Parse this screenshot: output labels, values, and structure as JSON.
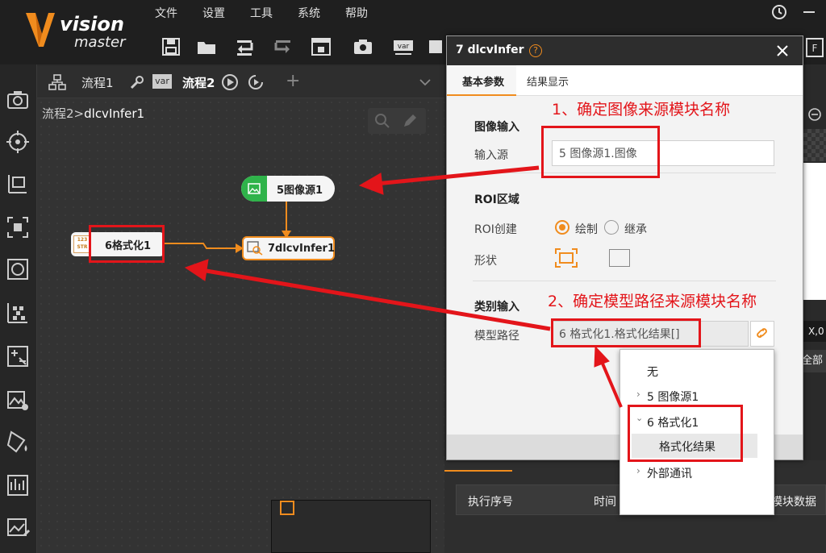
{
  "app": {
    "logo_line1": "vision",
    "logo_line2": "master"
  },
  "menu": [
    "文件",
    "设置",
    "工具",
    "系统",
    "帮助"
  ],
  "tabs": {
    "flow1": "流程1",
    "var": "var",
    "flow2": "流程2",
    "add": "+"
  },
  "breadcrumb": {
    "parent": "流程2",
    "sep": ">",
    "current": "dlcvInfer1"
  },
  "nodes": {
    "image_source": "5图像源1",
    "format": "6格式化1",
    "infer": "7dlcvInfer1"
  },
  "annotations": {
    "step1": "1、确定图像来源模块名称",
    "step2": "2、确定模型路径来源模块名称"
  },
  "dialog": {
    "title": "7 dlcvInfer",
    "tabs": [
      "基本参数",
      "结果显示"
    ],
    "image_input_section": "图像输入",
    "input_source_label": "输入源",
    "input_source_value": "5 图像源1.图像",
    "roi_section": "ROI区域",
    "roi_create_label": "ROI创建",
    "roi_option_draw": "绘制",
    "roi_option_inherit": "继承",
    "shape_label": "形状",
    "class_input_section": "类别输入",
    "model_path_label": "模型路径",
    "model_path_value": "6 格式化1.格式化结果[]"
  },
  "dropdown": {
    "none": "无",
    "item_image_source": "5 图像源1",
    "item_format": "6 格式化1",
    "item_format_result": "格式化结果",
    "item_external": "外部通讯"
  },
  "right_panel": {
    "coord": "X,0",
    "all": "全部"
  },
  "bottom_panel": {
    "col_exec": "执行序号",
    "col_time": "时间",
    "col_module": "模块数据"
  },
  "colors": {
    "accent": "#f08c1e",
    "annotation": "#e3151a",
    "green": "#2fb34a"
  }
}
